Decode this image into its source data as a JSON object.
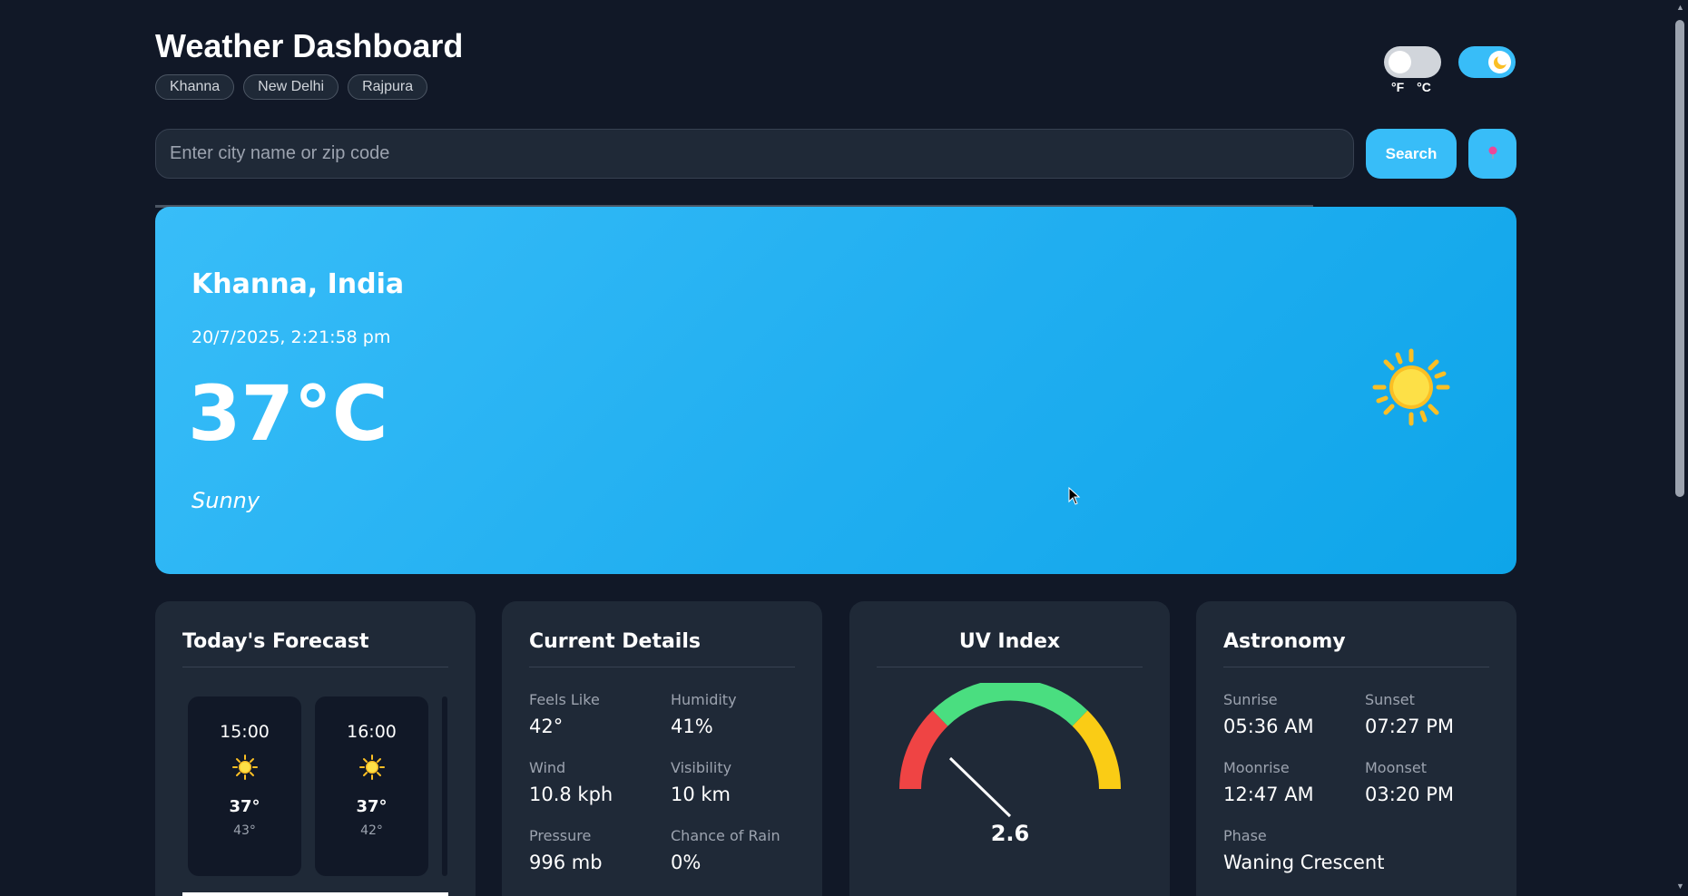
{
  "header": {
    "title": "Weather Dashboard",
    "recent_cities": [
      "Khanna",
      "New Delhi",
      "Rajpura"
    ],
    "unit_labels": {
      "f": "°F",
      "c": "°C"
    }
  },
  "search": {
    "placeholder": "Enter city name or zip code",
    "button_label": "Search",
    "location_icon": "map-pin-icon"
  },
  "current": {
    "location": "Khanna, India",
    "datetime": "20/7/2025, 2:21:58 pm",
    "temperature": "37°C",
    "condition": "Sunny",
    "icon": "sun-icon"
  },
  "forecast": {
    "title": "Today's Forecast",
    "hours": [
      {
        "time": "15:00",
        "temp": "37°",
        "feels": "43°",
        "icon": "sun-icon"
      },
      {
        "time": "16:00",
        "temp": "37°",
        "feels": "42°",
        "icon": "sun-icon"
      }
    ]
  },
  "details": {
    "title": "Current Details",
    "items": [
      {
        "label": "Feels Like",
        "value": "42°"
      },
      {
        "label": "Humidity",
        "value": "41%"
      },
      {
        "label": "Wind",
        "value": "10.8 kph"
      },
      {
        "label": "Visibility",
        "value": "10 km"
      },
      {
        "label": "Pressure",
        "value": "996 mb"
      },
      {
        "label": "Chance of Rain",
        "value": "0%"
      }
    ]
  },
  "uv": {
    "title": "UV Index",
    "value": "2.6",
    "colors": {
      "low": "#ef4444",
      "mid": "#4ade80",
      "high": "#facc15"
    }
  },
  "astronomy": {
    "title": "Astronomy",
    "items": [
      {
        "label": "Sunrise",
        "value": "05:36 AM"
      },
      {
        "label": "Sunset",
        "value": "07:27 PM"
      },
      {
        "label": "Moonrise",
        "value": "12:47 AM"
      },
      {
        "label": "Moonset",
        "value": "03:20 PM"
      },
      {
        "label": "Phase",
        "value": "Waning Crescent"
      }
    ]
  },
  "colors": {
    "background": "#111827",
    "card": "#1f2937",
    "accent": "#38bdf8"
  }
}
